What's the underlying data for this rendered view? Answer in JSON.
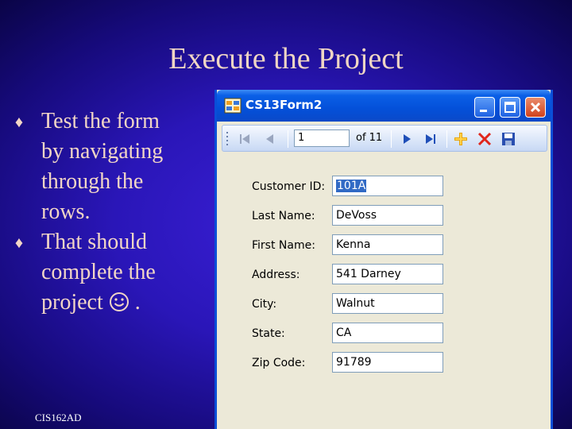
{
  "slide": {
    "title": "Execute the Project",
    "bullets": [
      {
        "lines": [
          "Test the form",
          "by navigating",
          "through the",
          "rows."
        ]
      },
      {
        "lines": [
          "That should",
          "complete the",
          "project"
        ],
        "suffix": "."
      }
    ],
    "bullet_glyph": "♦",
    "footer": "CIS162AD"
  },
  "window": {
    "title": "CS13Form2",
    "icon": "form-grid-icon",
    "title_buttons": [
      "minimize-icon",
      "maximize-icon",
      "close-icon"
    ]
  },
  "navigator": {
    "position": "1",
    "count_label": "of 11",
    "icons": [
      "move-first-icon",
      "move-previous-icon",
      "move-next-icon",
      "move-last-icon",
      "add-new-icon",
      "delete-icon",
      "save-icon"
    ]
  },
  "fields": [
    {
      "label": "Customer ID:",
      "value": "101A",
      "selected": true
    },
    {
      "label": "Last Name:",
      "value": "DeVoss"
    },
    {
      "label": "First Name:",
      "value": "Kenna"
    },
    {
      "label": "Address:",
      "value": "541 Darney"
    },
    {
      "label": "City:",
      "value": "Walnut"
    },
    {
      "label": "State:",
      "value": "CA"
    },
    {
      "label": "Zip Code:",
      "value": "91789"
    }
  ],
  "colors": {
    "background": "#2a16b8",
    "title_text": "#f0d6c4",
    "window_frame": "#0a4fd8",
    "selection": "#316ac5"
  }
}
